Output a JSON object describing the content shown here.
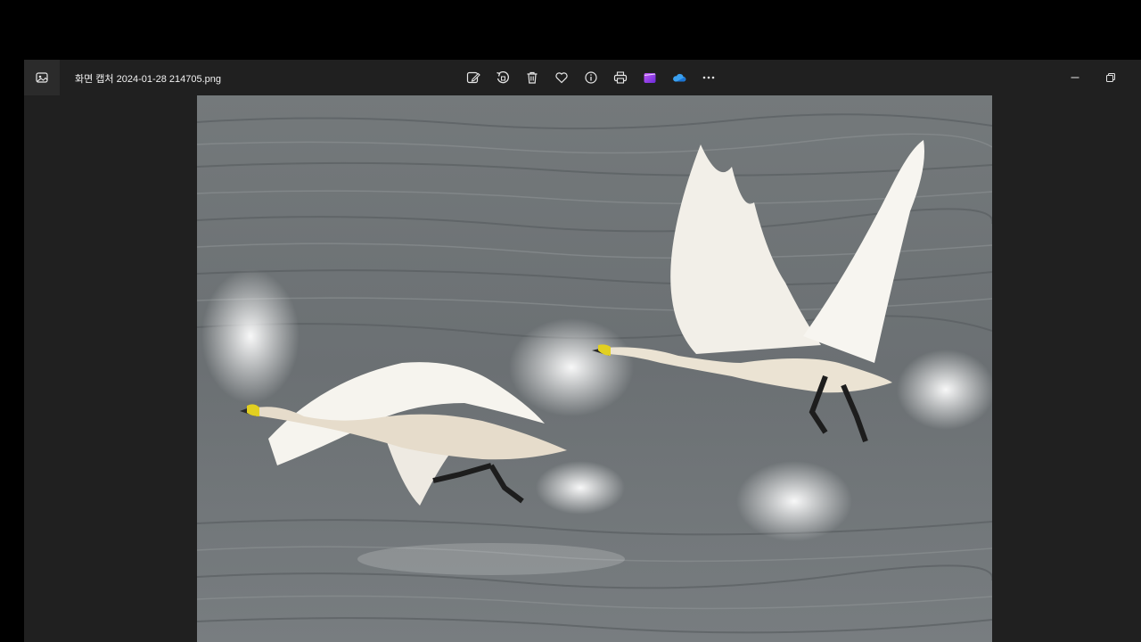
{
  "window": {
    "file_name": "화면 캡처 2024-01-28 214705.png"
  },
  "toolbar": {
    "buttons": [
      {
        "name": "edit-image-icon"
      },
      {
        "name": "rotate-icon"
      },
      {
        "name": "delete-icon"
      },
      {
        "name": "favorite-heart-icon"
      },
      {
        "name": "file-info-icon"
      },
      {
        "name": "print-icon"
      },
      {
        "name": "clipchamp-icon"
      },
      {
        "name": "onedrive-cloud-icon"
      },
      {
        "name": "more-options-icon"
      }
    ]
  },
  "window_controls": [
    "minimize-icon",
    "restore-icon"
  ],
  "colors": {
    "window_bg": "#202020",
    "icon": "#e6e6e6",
    "onedrive": "#3aa0f0",
    "clipchamp": "#8a3cf0",
    "water": "#6b7073",
    "swan": "#f4f1ea"
  },
  "image": {
    "subject": "two-swans-taking-off-from-water"
  }
}
